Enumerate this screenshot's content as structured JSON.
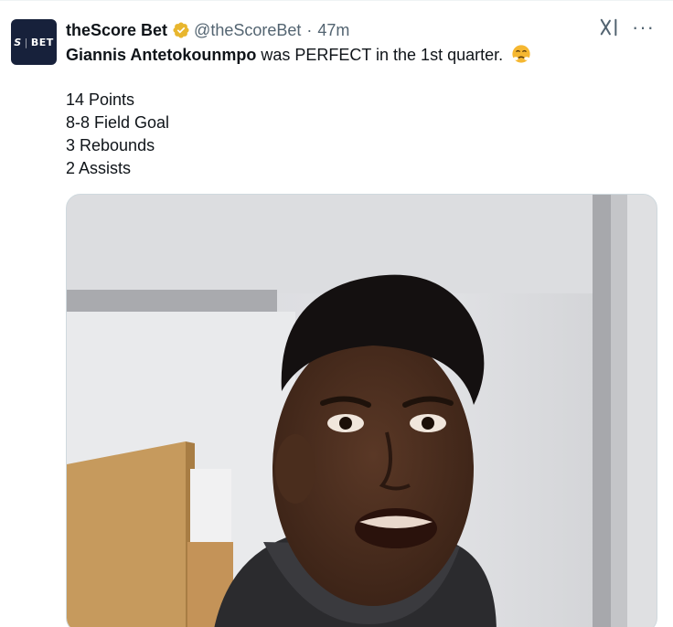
{
  "account": {
    "avatar_text_s": "S",
    "avatar_text_bet": "BET",
    "display_name": "theScore Bet",
    "handle": "@theScoreBet",
    "separator": "·",
    "time": "47m"
  },
  "tweet": {
    "mention": "Giannis Antetokounmpo",
    "text_rest": " was PERFECT in the 1st quarter.",
    "stats": [
      "14 Points",
      "8-8 Field Goal",
      "3 Rebounds",
      "2 Assists"
    ]
  },
  "colors": {
    "verified_badge": "#e8b62e",
    "emoji": "#f5b731",
    "secondary_text": "#536471"
  },
  "icons": {
    "verified": "verified-gold-badge-icon",
    "grok": "grok-icon",
    "more": "more-icon",
    "emoji": "steam-nose-emoji-icon"
  }
}
